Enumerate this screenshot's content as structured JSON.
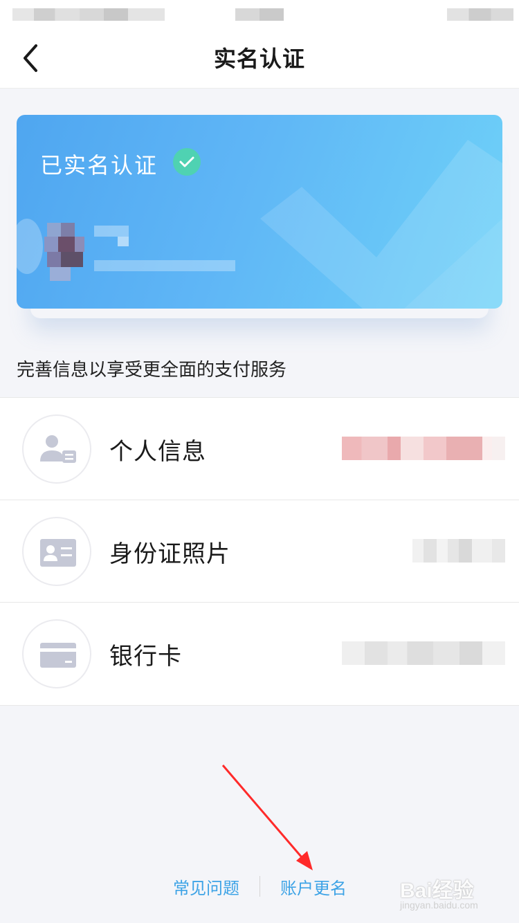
{
  "nav": {
    "title": "实名认证"
  },
  "card": {
    "status": "已实名认证"
  },
  "hint": "完善信息以享受更全面的支付服务",
  "list": {
    "items": [
      {
        "label": "个人信息",
        "icon": "person-card-icon"
      },
      {
        "label": "身份证照片",
        "icon": "id-card-icon"
      },
      {
        "label": "银行卡",
        "icon": "bank-card-icon"
      }
    ]
  },
  "footer": {
    "faq": "常见问题",
    "rename": "账户更名"
  },
  "watermark": {
    "main": "Bai经验",
    "sub": "jingyan.baidu.com"
  },
  "colors": {
    "accent": "#3da3e6",
    "badge": "#4fd2b2",
    "arrow": "#ff2a2a"
  }
}
